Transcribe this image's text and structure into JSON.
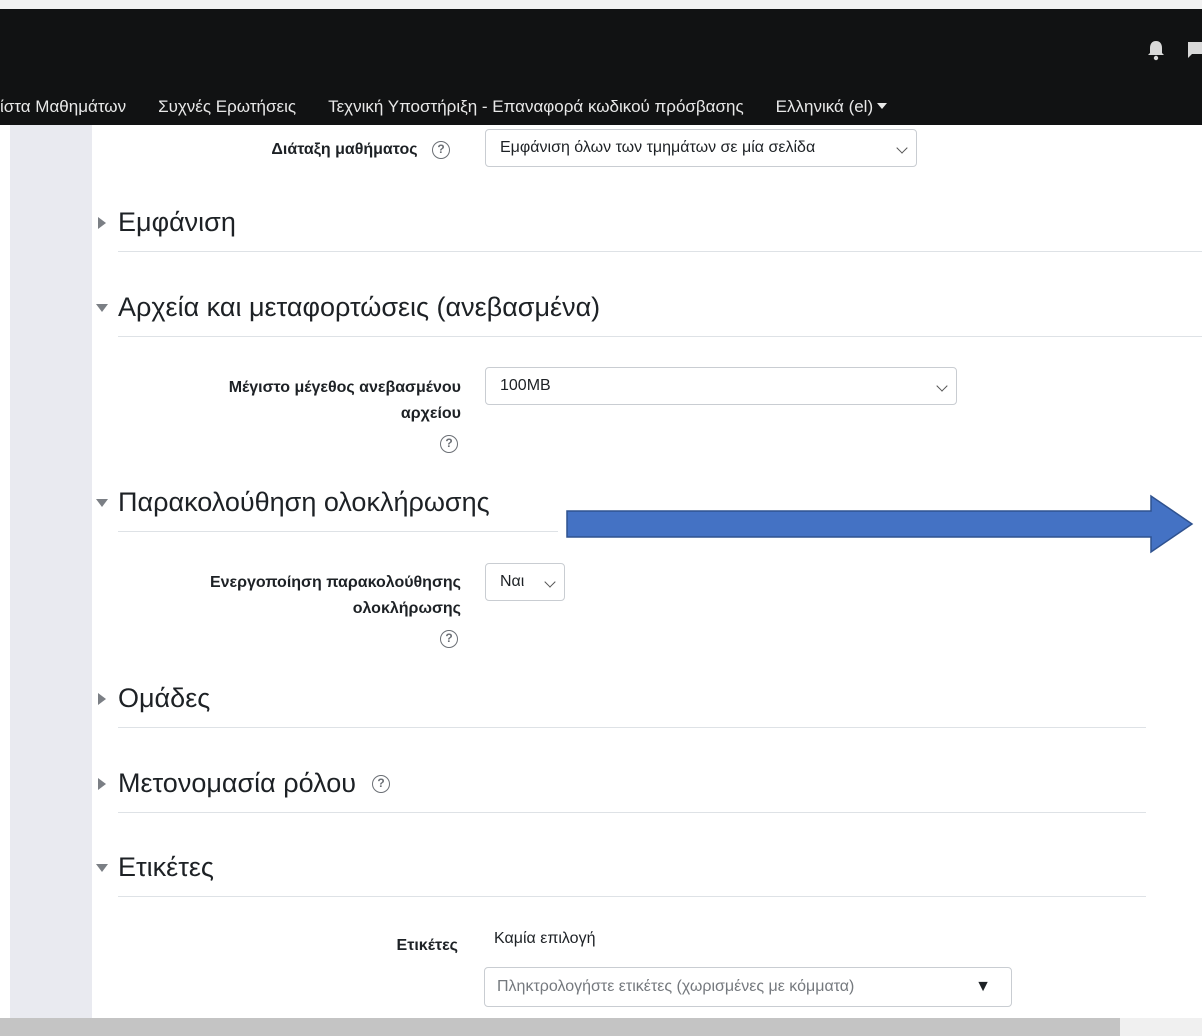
{
  "nav": {
    "items": [
      {
        "label": "ίστα Μαθημάτων"
      },
      {
        "label": "Συχνές Ερωτήσεις"
      },
      {
        "label": "Τεχνική Υποστήριξη - Επαναφορά κωδικού πρόσβασης"
      },
      {
        "label": "Ελληνικά (el)"
      }
    ]
  },
  "icons": {
    "help": "?"
  },
  "form": {
    "course_layout": {
      "label": "Διάταξη μαθήματος",
      "value": "Εμφάνιση όλων των τμημάτων σε μία σελίδα"
    },
    "appearance": {
      "heading": "Εμφάνιση"
    },
    "files": {
      "heading": "Αρχεία και μεταφορτώσεις (ανεβασμένα)",
      "max_size_label_line1": "Μέγιστο μέγεθος ανεβασμένου",
      "max_size_label_line2": "αρχείου",
      "max_size_value": "100MB"
    },
    "completion": {
      "heading": "Παρακολούθηση ολοκλήρωσης",
      "enable_label_line1": "Ενεργοποίηση παρακολούθησης",
      "enable_label_line2": "ολοκλήρωσης",
      "enable_value": "Ναι"
    },
    "groups": {
      "heading": "Ομάδες"
    },
    "role_renaming": {
      "heading": "Μετονομασία ρόλου"
    },
    "tags": {
      "heading": "Ετικέτες",
      "label": "Ετικέτες",
      "selected": "Καμία επιλογή",
      "placeholder": "Πληκτρολογήστε ετικέτες (χωρισμένες με κόμματα)",
      "dropdown_glyph": "▼"
    }
  },
  "colors": {
    "navbar": "#111213",
    "sidebar": "#e9eaf0",
    "arrow_fill": "#4472c4",
    "arrow_stroke": "#2f528f"
  }
}
